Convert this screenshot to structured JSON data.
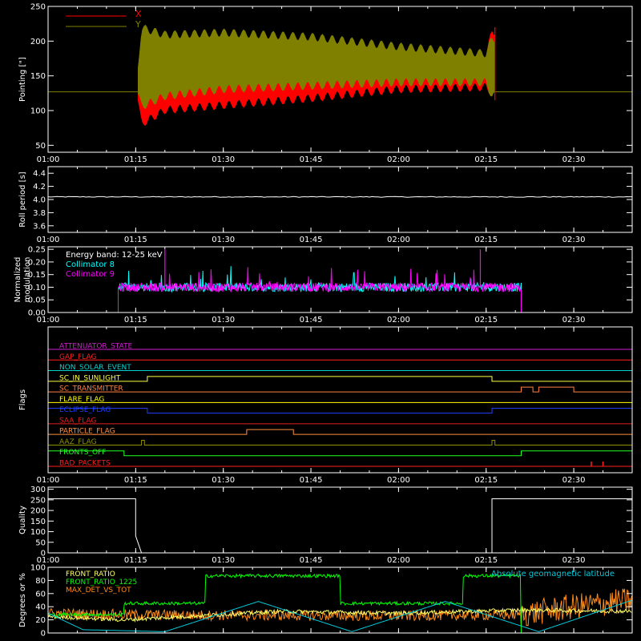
{
  "colors": {
    "background": "#000000",
    "axes": "#ffffff",
    "x_pointing": "#ff0000",
    "y_pointing": "#808000",
    "roll_period": "#ffffff",
    "collimator_8": "#00ffff",
    "collimator_9": "#ff00ff",
    "quality": "#ffffff",
    "front_ratio": "#ffff66",
    "front_ratio_1225": "#00ff00",
    "max_det_vs_tot": "#ff8c1a",
    "geomagnetic": "#00ccdd"
  },
  "time_axis": {
    "start": "01:00",
    "end": "02:40",
    "tick_labels": [
      "01:00",
      "01:15",
      "01:30",
      "01:45",
      "02:00",
      "02:15",
      "02:30"
    ]
  },
  "chart_data": [
    {
      "type": "line",
      "ylabel": "Pointing [\"]",
      "ylim": [
        40,
        250
      ],
      "yticks": [
        "50",
        "100",
        "150",
        "200",
        "250"
      ],
      "legend": [
        {
          "name": "X"
        },
        {
          "name": "Y"
        }
      ],
      "legend_position": "top-left",
      "baseline": 127,
      "series": [
        {
          "name": "X",
          "x": [
            "01:15",
            "01:16",
            "01:20",
            "01:30",
            "01:45",
            "02:00",
            "02:15",
            "02:16"
          ],
          "min": [
            130,
            75,
            95,
            102,
            112,
            125,
            128,
            120
          ],
          "max": [
            130,
            215,
            210,
            212,
            208,
            195,
            185,
            220
          ]
        },
        {
          "name": "Y",
          "x": [
            "01:15",
            "01:16",
            "01:20",
            "01:30",
            "01:45",
            "02:00",
            "02:15",
            "02:16"
          ],
          "min": [
            130,
            100,
            115,
            125,
            130,
            135,
            135,
            115
          ],
          "max": [
            130,
            225,
            215,
            218,
            212,
            198,
            188,
            210
          ]
        }
      ]
    },
    {
      "type": "line",
      "ylabel": "Roll period [s]",
      "ylim": [
        3.5,
        4.5
      ],
      "yticks": [
        "3.6",
        "3.8",
        "4.0",
        "4.2",
        "4.4"
      ],
      "series": [
        {
          "name": "Roll period",
          "x": [
            "01:00",
            "02:40"
          ],
          "y": [
            4.04,
            4.04
          ]
        }
      ]
    },
    {
      "type": "line",
      "ylabel_lines": [
        "Normalized",
        "modulation"
      ],
      "ylim": [
        0,
        0.26
      ],
      "yticks": [
        "0.00",
        "0.05",
        "0.10",
        "0.15",
        "0.20",
        "0.25"
      ],
      "annotation": "Energy band: 12-25 keV",
      "legend": [
        {
          "name": "Collimator 8"
        },
        {
          "name": "Collimator 9"
        }
      ],
      "active_range": [
        "01:12",
        "02:21"
      ],
      "typical_value": 0.1,
      "series": [
        {
          "name": "Collimator 8",
          "x": [
            "01:12",
            "02:21"
          ],
          "y": [
            0.1,
            0.1
          ]
        },
        {
          "name": "Collimator 9",
          "x": [
            "01:12",
            "02:21"
          ],
          "y": [
            0.1,
            0.1
          ]
        }
      ]
    },
    {
      "type": "line",
      "ylabel": "Flags",
      "flags": [
        {
          "name": "ATTENUATOR_STATE",
          "color": "#d020d0",
          "steps": []
        },
        {
          "name": "GAP_FLAG",
          "color": "#ff2020",
          "steps": []
        },
        {
          "name": "NON_SOLAR_EVENT",
          "color": "#00d0d0",
          "steps": []
        },
        {
          "name": "SC_IN_SUNLIGHT",
          "color": "#ffff40",
          "steps": [
            [
              "01:17",
              "02:16"
            ]
          ]
        },
        {
          "name": "SC_TRANSMITTER",
          "color": "#ff8040",
          "steps": [
            [
              "02:21",
              "02:23"
            ],
            [
              "02:24",
              "02:30"
            ]
          ]
        },
        {
          "name": "FLARE_FLAG",
          "color": "#ffff00",
          "steps": []
        },
        {
          "name": "ECLIPSE_FLAG",
          "color": "#2040ff",
          "steps": [
            [
              "01:00",
              "01:17"
            ],
            [
              "02:16",
              "02:40"
            ]
          ]
        },
        {
          "name": "SAA_FLAG",
          "color": "#e02020",
          "steps": []
        },
        {
          "name": "PARTICLE_FLAG",
          "color": "#ff9040",
          "steps": [
            [
              "01:34",
              "01:42"
            ]
          ]
        },
        {
          "name": "AAZ_FLAG",
          "color": "#909000",
          "steps": [
            [
              "01:16",
              "01:16.5"
            ],
            [
              "02:16",
              "02:16.5"
            ]
          ]
        },
        {
          "name": "FRONTS_OFF",
          "color": "#20ff20",
          "steps": [
            [
              "01:00",
              "01:13"
            ],
            [
              "02:21",
              "02:40"
            ]
          ]
        },
        {
          "name": "BAD_PACKETS",
          "color": "#ff2020",
          "steps": [],
          "spikes": [
            "02:33",
            "02:35"
          ]
        }
      ]
    },
    {
      "type": "line",
      "ylabel": "Quality",
      "ylim": [
        0,
        310
      ],
      "yticks": [
        "0",
        "50",
        "100",
        "150",
        "200",
        "250",
        "300"
      ],
      "series": [
        {
          "name": "Quality",
          "x": [
            "01:00",
            "01:15",
            "01:15",
            "01:16",
            "02:16",
            "02:16",
            "02:40"
          ],
          "y": [
            255,
            255,
            80,
            0,
            0,
            255,
            255
          ]
        }
      ]
    },
    {
      "type": "line",
      "ylabel": "Degrees or %",
      "ylim": [
        0,
        100
      ],
      "yticks": [
        "0",
        "20",
        "40",
        "60",
        "80",
        "100"
      ],
      "legend": [
        {
          "name": "FRONT_RATIO"
        },
        {
          "name": "FRONT_RATIO_1225"
        },
        {
          "name": "MAX_DET_VS_TOT"
        }
      ],
      "side_legend": "Absolute geomagnetic latitude",
      "series": [
        {
          "name": "FRONT_RATIO",
          "x": [
            "01:00",
            "01:13",
            "01:40",
            "02:00",
            "02:21",
            "02:40"
          ],
          "y": [
            25,
            20,
            33,
            30,
            35,
            33
          ]
        },
        {
          "name": "FRONT_RATIO_1225",
          "x": [
            "01:00",
            "01:13",
            "01:13",
            "01:27",
            "01:27",
            "01:50",
            "01:50",
            "02:11",
            "02:11",
            "02:21",
            "02:21",
            "02:40"
          ],
          "y": [
            28,
            28,
            45,
            45,
            87,
            87,
            45,
            45,
            87,
            87,
            0,
            0
          ]
        },
        {
          "name": "MAX_DET_VS_TOT",
          "x": [
            "01:00",
            "01:13",
            "01:30",
            "02:00",
            "02:21",
            "02:30",
            "02:40"
          ],
          "y": [
            30,
            28,
            27,
            26,
            28,
            40,
            50
          ]
        },
        {
          "name": "Absolute geomagnetic latitude",
          "x": [
            "01:00",
            "01:06",
            "01:20",
            "01:36",
            "01:52",
            "02:08",
            "02:24",
            "02:40"
          ],
          "y": [
            30,
            5,
            2,
            48,
            2,
            48,
            2,
            50
          ]
        }
      ]
    }
  ]
}
